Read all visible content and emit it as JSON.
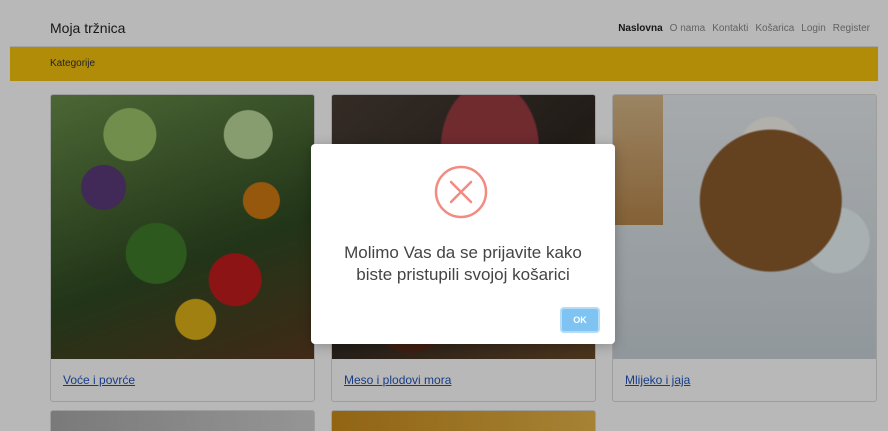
{
  "navbar": {
    "brand": "Moja tržnica",
    "links": [
      "Naslovna",
      "O nama",
      "Kontakti",
      "Košarica",
      "Login",
      "Register"
    ],
    "active_index": 0
  },
  "category_bar": {
    "label": "Kategorije"
  },
  "cards": [
    {
      "label": "Voće i povrće"
    },
    {
      "label": "Meso i plodovi mora"
    },
    {
      "label": "Mlijeko i jaja"
    }
  ],
  "modal": {
    "message_line1": "Molimo Vas da se prijavite kako",
    "message_line2": "biste pristupili svojoj košarici",
    "ok_label": "OK",
    "icon": "error-x-circle-icon"
  },
  "colors": {
    "accent_yellow": "#f4c20d",
    "error_red": "#f28b82",
    "ok_blue": "#7ec3f2",
    "link_blue": "#2255bb"
  }
}
